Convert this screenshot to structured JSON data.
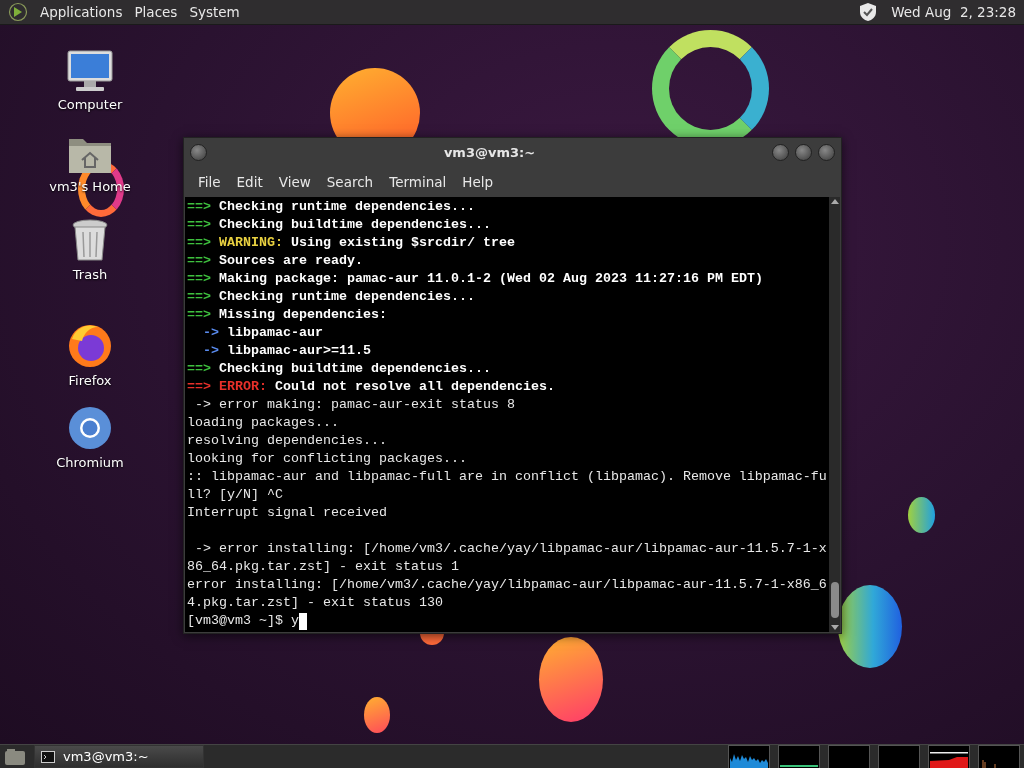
{
  "top_panel": {
    "menus": [
      "Applications",
      "Places",
      "System"
    ],
    "clock": "Wed Aug  2, 23:28"
  },
  "desktop_icons": [
    {
      "kind": "computer",
      "label": "Computer"
    },
    {
      "kind": "home",
      "label": "vm3's Home"
    },
    {
      "kind": "trash",
      "label": "Trash"
    },
    {
      "kind": "firefox",
      "label": "Firefox"
    },
    {
      "kind": "chromium",
      "label": "Chromium"
    }
  ],
  "window": {
    "title": "vm3@vm3:~",
    "menu": [
      "File",
      "Edit",
      "View",
      "Search",
      "Terminal",
      "Help"
    ],
    "lines": [
      {
        "segments": [
          {
            "kind": "arrow",
            "text": "==>"
          },
          {
            "kind": "bold",
            "text": " Checking runtime dependencies..."
          }
        ]
      },
      {
        "segments": [
          {
            "kind": "arrow",
            "text": "==>"
          },
          {
            "kind": "bold",
            "text": " Checking buildtime dependencies..."
          }
        ]
      },
      {
        "segments": [
          {
            "kind": "arrow",
            "text": "==>"
          },
          {
            "kind": "warning",
            "text": " WARNING:"
          },
          {
            "kind": "bold",
            "text": " Using existing $srcdir/ tree"
          }
        ]
      },
      {
        "segments": [
          {
            "kind": "arrow",
            "text": "==>"
          },
          {
            "kind": "bold",
            "text": " Sources are ready."
          }
        ]
      },
      {
        "segments": [
          {
            "kind": "arrow",
            "text": "==>"
          },
          {
            "kind": "bold",
            "text": " Making package: pamac-aur 11.0.1-2 (Wed 02 Aug 2023 11:27:16 PM EDT)"
          }
        ]
      },
      {
        "segments": [
          {
            "kind": "arrow",
            "text": "==>"
          },
          {
            "kind": "bold",
            "text": " Checking runtime dependencies..."
          }
        ]
      },
      {
        "segments": [
          {
            "kind": "arrow",
            "text": "==>"
          },
          {
            "kind": "bold",
            "text": " Missing dependencies:"
          }
        ]
      },
      {
        "segments": [
          {
            "kind": "sub",
            "text": "  ->"
          },
          {
            "kind": "bold",
            "text": " libpamac-aur"
          }
        ]
      },
      {
        "segments": [
          {
            "kind": "sub",
            "text": "  ->"
          },
          {
            "kind": "bold",
            "text": " libpamac-aur>=11.5"
          }
        ]
      },
      {
        "segments": [
          {
            "kind": "arrow",
            "text": "==>"
          },
          {
            "kind": "bold",
            "text": " Checking buildtime dependencies..."
          }
        ]
      },
      {
        "segments": [
          {
            "kind": "error",
            "text": "==> ERROR:"
          },
          {
            "kind": "bold",
            "text": " Could not resolve all dependencies."
          }
        ]
      },
      {
        "segments": [
          {
            "kind": "plain",
            "text": " -> error making: pamac-aur-exit status 8"
          }
        ]
      },
      {
        "segments": [
          {
            "kind": "plain",
            "text": "loading packages..."
          }
        ]
      },
      {
        "segments": [
          {
            "kind": "plain",
            "text": "resolving dependencies..."
          }
        ]
      },
      {
        "segments": [
          {
            "kind": "plain",
            "text": "looking for conflicting packages..."
          }
        ]
      },
      {
        "segments": [
          {
            "kind": "plain",
            "text": ":: libpamac-aur and libpamac-full are in conflict (libpamac). Remove libpamac-fu"
          }
        ]
      },
      {
        "segments": [
          {
            "kind": "plain",
            "text": "ll? [y/N] ^C"
          }
        ]
      },
      {
        "segments": [
          {
            "kind": "plain",
            "text": "Interrupt signal received"
          }
        ]
      },
      {
        "blank_before": true,
        "segments": [
          {
            "kind": "plain",
            "text": " -> error installing: [/home/vm3/.cache/yay/libpamac-aur/libpamac-aur-11.5.7-1-x"
          }
        ]
      },
      {
        "segments": [
          {
            "kind": "plain",
            "text": "86_64.pkg.tar.zst] - exit status 1"
          }
        ]
      },
      {
        "segments": [
          {
            "kind": "plain",
            "text": "error installing: [/home/vm3/.cache/yay/libpamac-aur/libpamac-aur-11.5.7-1-x86_6"
          }
        ]
      },
      {
        "segments": [
          {
            "kind": "plain",
            "text": "4.pkg.tar.zst] - exit status 130"
          }
        ]
      },
      {
        "cursor": true,
        "segments": [
          {
            "kind": "plain",
            "text": "[vm3@vm3 ~]$ y"
          }
        ]
      }
    ]
  },
  "taskbar": {
    "tasks": [
      {
        "label": "vm3@vm3:~",
        "selected": true
      }
    ]
  }
}
